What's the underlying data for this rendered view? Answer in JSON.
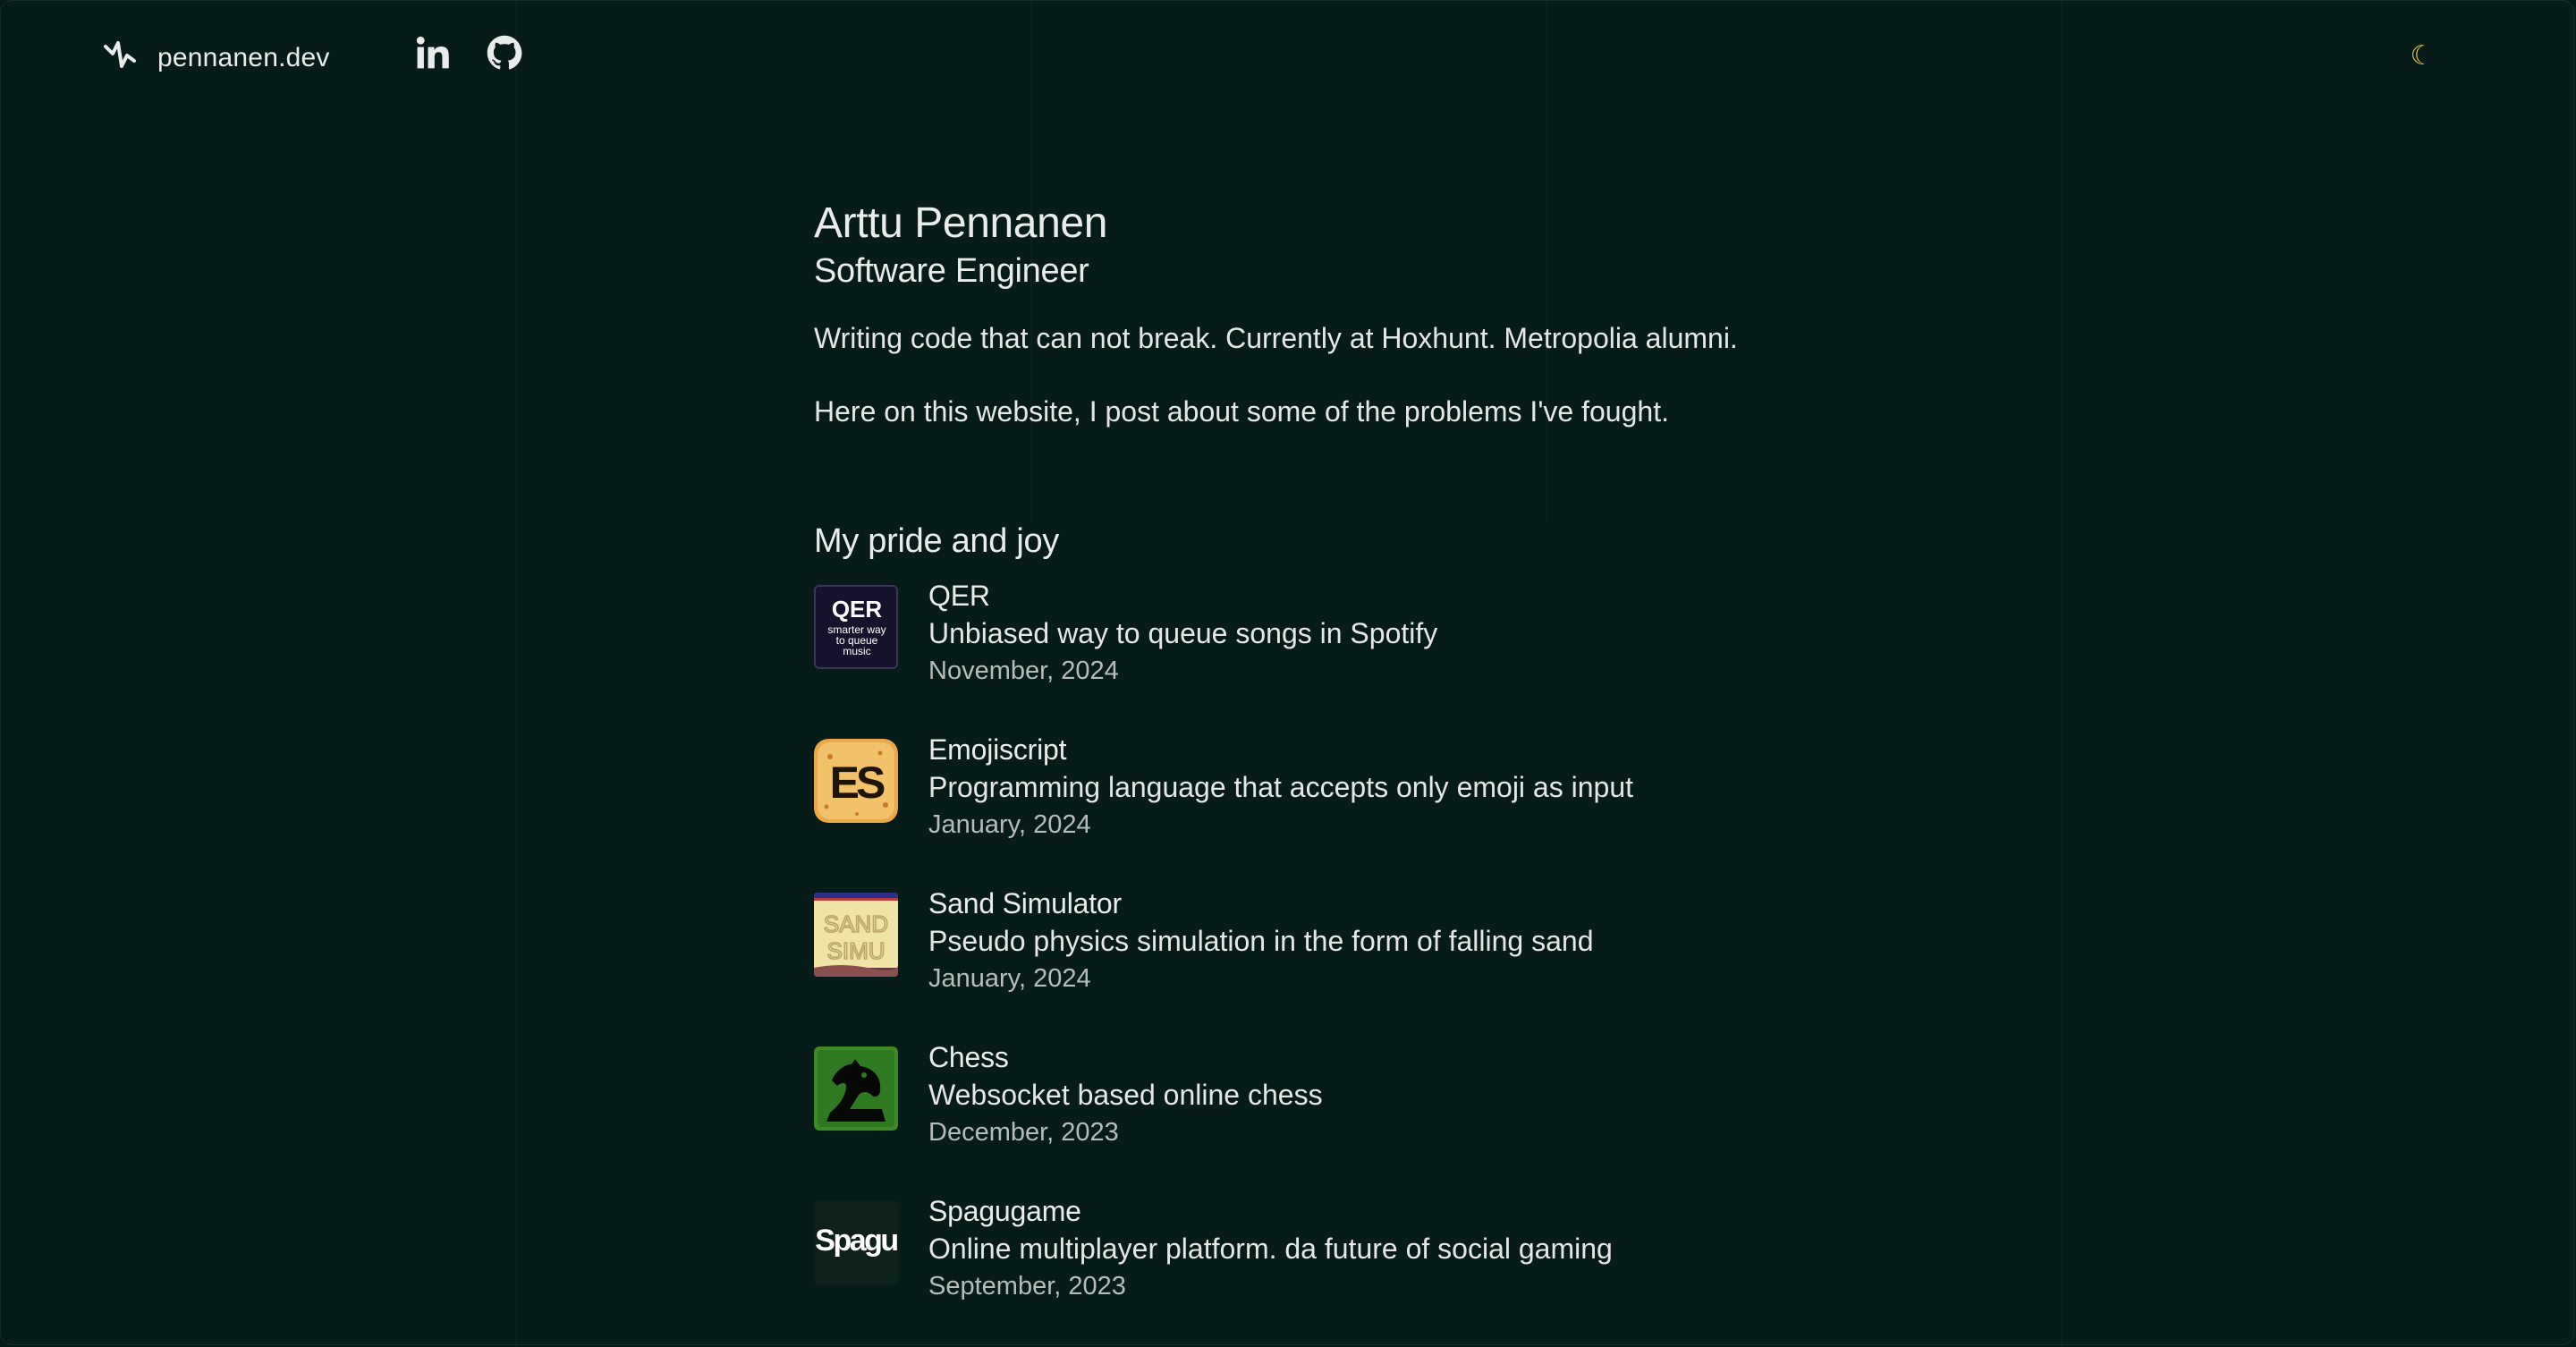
{
  "header": {
    "site_name": "pennanen.dev",
    "theme_icon": "☾",
    "icons": {
      "logo": "bolt-icon",
      "linkedin": "linkedin-icon",
      "github": "github-icon",
      "theme": "moon-icon"
    }
  },
  "profile": {
    "name": "Arttu Pennanen",
    "role": "Software Engineer",
    "bio_1": "Writing code that can not break. Currently at Hoxhunt. Metropolia alumni.",
    "bio_2": "Here on this website, I post about some of the problems I've fought."
  },
  "projects_section": {
    "title": "My pride and joy",
    "items": [
      {
        "title": "QER",
        "description": "Unbiased way to queue songs in Spotify",
        "date": "November, 2024",
        "thumb_text": "QER",
        "thumb_sub_1": "smarter way",
        "thumb_sub_2": "to queue",
        "thumb_sub_3": "music"
      },
      {
        "title": "Emojiscript",
        "description": "Programming language that accepts only emoji as input",
        "date": "January, 2024",
        "thumb_text": "ES"
      },
      {
        "title": "Sand Simulator",
        "description": "Pseudo physics simulation in the form of falling sand",
        "date": "January, 2024",
        "thumb_text_1": "SAND",
        "thumb_text_2": "SIMU"
      },
      {
        "title": "Chess",
        "description": "Websocket based online chess",
        "date": "December, 2023"
      },
      {
        "title": "Spagugame",
        "description": "Online multiplayer platform. da future of social gaming",
        "date": "September, 2023",
        "thumb_text": "Spagu"
      }
    ]
  },
  "colors": {
    "background": "#071b18",
    "text": "#e8ecea",
    "muted": "#b4bdba",
    "accent": "#e4c54a"
  }
}
